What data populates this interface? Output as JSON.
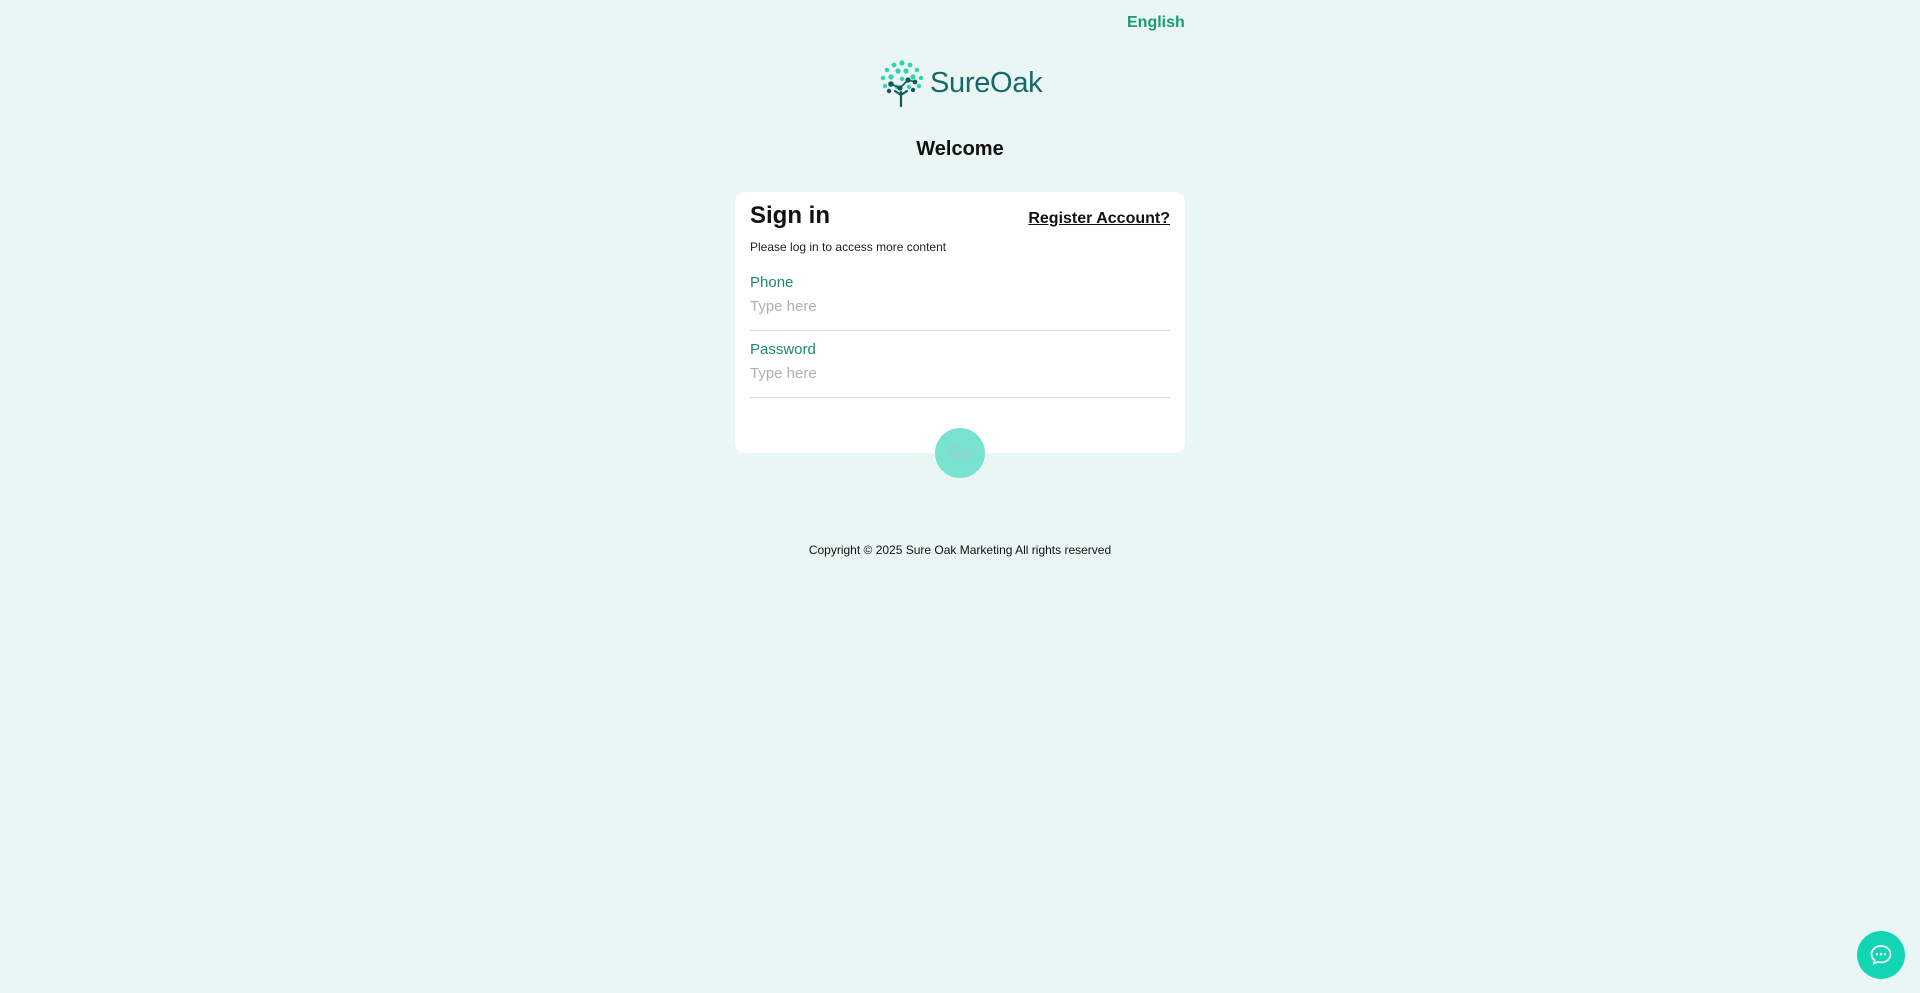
{
  "header": {
    "language": "English"
  },
  "brand": {
    "name": "SureOak",
    "color": "#17686a",
    "icon": "tree-logo-icon"
  },
  "welcome": "Welcome",
  "signin": {
    "title": "Sign in",
    "register_link": "Register Account?",
    "subtitle": "Please log in to access more content",
    "phone": {
      "label": "Phone",
      "placeholder": "Type here",
      "value": ""
    },
    "password": {
      "label": "Password",
      "placeholder": "Type here",
      "value": ""
    },
    "submit_label": "Go"
  },
  "footer": {
    "copyright": "Copyright © 2025 Sure Oak Marketing All rights reserved"
  },
  "chat": {
    "icon": "chat-bubble-icon"
  },
  "colors": {
    "background": "#e9f6f3",
    "accent": "#1a9a7a",
    "button_disabled": "#79e1cf",
    "chat_button": "#12d6b3"
  }
}
